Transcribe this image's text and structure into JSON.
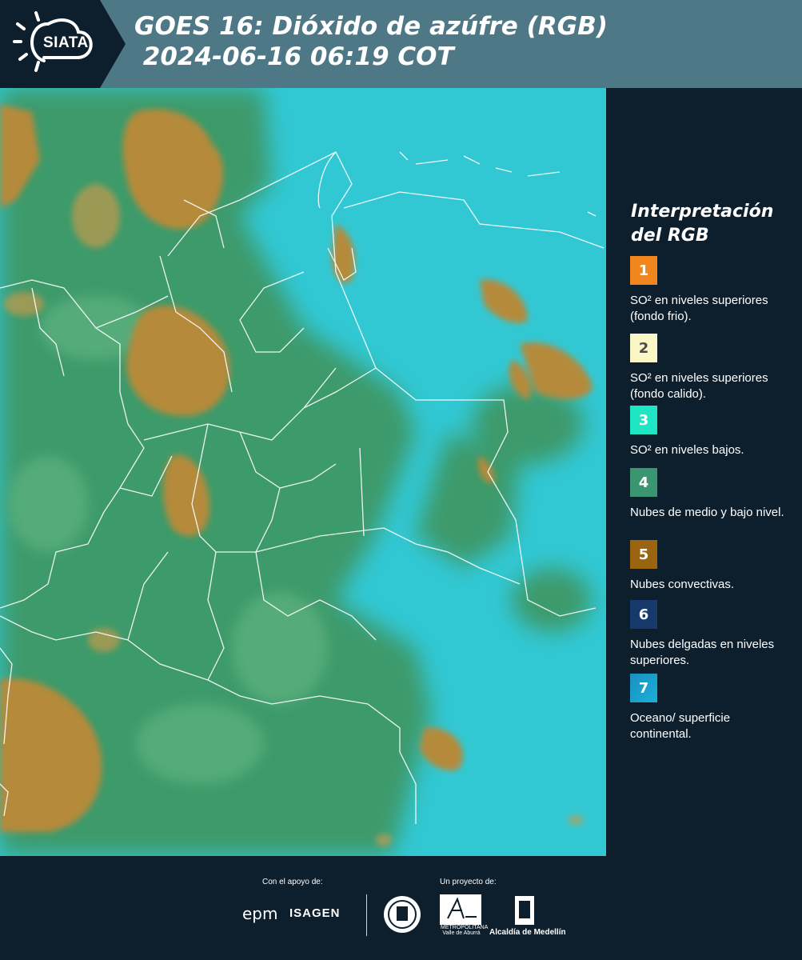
{
  "header": {
    "logo_text": "SIATA",
    "title": "GOES 16: Dióxido de azúfre (RGB)\n 2024-06-16 06:19 COT"
  },
  "legend": {
    "title": "Interpretación del RGB",
    "items": [
      {
        "number": "1",
        "label": "SO² en niveles superiores (fondo frio).",
        "color": "#f0861d",
        "text_color": "#ffffff"
      },
      {
        "number": "2",
        "label": "SO² en niveles superiores (fondo calido).",
        "color": "#fbf6c5",
        "text_color": "#4a4a4a"
      },
      {
        "number": "3",
        "label": "SO² en niveles bajos.",
        "color": "#1ee5c4",
        "text_color": "#ffffff"
      },
      {
        "number": "4",
        "label": "Nubes de medio y bajo nivel.",
        "color": "#3a9670",
        "text_color": "#ffffff"
      },
      {
        "number": "5",
        "label": "Nubes convectivas.",
        "color": "#9b640e",
        "text_color": "#ffffff"
      },
      {
        "number": "6",
        "label": "Nubes delgadas en niveles superiores.",
        "color": "#163a6b",
        "text_color": "#ffffff"
      },
      {
        "number": "7",
        "label": "Oceano/ superficie continental.",
        "color": "#1a8fbf",
        "text_color": "#ffffff"
      }
    ]
  },
  "footer": {
    "support_label": "Con el apoyo de:",
    "project_label": "Un proyecto de:",
    "epm": "epm",
    "isagen": "ISAGEN",
    "area_sub": "METROPOLITANA Valle de Aburrá",
    "alcaldia": "Alcaldía de Medellín"
  },
  "map": {
    "colors": {
      "background": "#2fc9d6",
      "green": "#3d9a6a",
      "orange": "#b9903f"
    }
  }
}
